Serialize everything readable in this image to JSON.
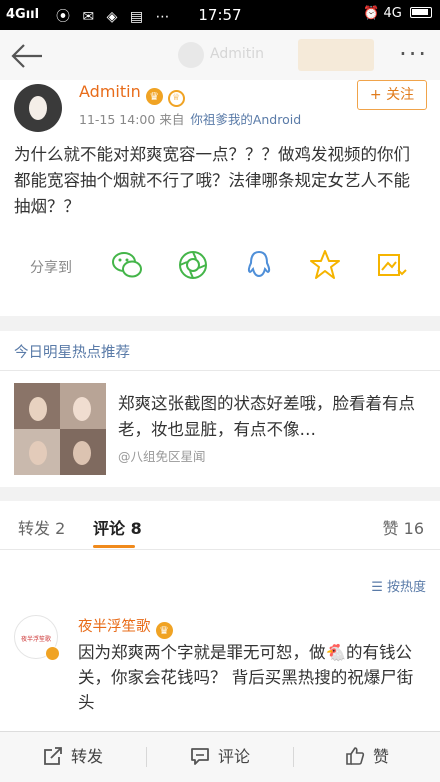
{
  "status": {
    "signal": "4Gııl",
    "time": "17:57",
    "right": "4G"
  },
  "post": {
    "author": "Admitin",
    "time": "11-15 14:00",
    "source_prefix": "来自",
    "source": "你祖爹我的Android",
    "follow_label": "+ 关注",
    "text": "为什么就不能对郑爽宽容一点？？？做鸡发视频的你们都能宽容抽个烟就不行了哦？法律哪条规定女艺人不能抽烟？？",
    "share_label": "分享到",
    "share_icons": [
      "wechat-icon",
      "moments-icon",
      "qq-icon",
      "favorite-star-icon",
      "qzone-icon"
    ]
  },
  "hot": {
    "title": "今日明星热点推荐",
    "text": "郑爽这张截图的状态好差哦，脸看着有点老，妆也显脏，有点不像…",
    "source": "@八组免区星闻"
  },
  "comments": {
    "tabs": {
      "repost": "转发 2",
      "comment": "评论 8",
      "like": "赞 16"
    },
    "sort_label": "按热度",
    "first": {
      "author": "夜半浮笙歌",
      "avatar_text": "夜半浮笙歌",
      "text": "因为郑爽两个字就是罪无可恕，做🐔的有钱公关，你家会花钱吗？ 背后买黑热搜的祝爆尸街头"
    }
  },
  "bottom_bar": {
    "repost": "转发",
    "comment": "评论",
    "like": "赞"
  },
  "colors": {
    "accent": "#f08a1c",
    "author": "#e86c1a",
    "link": "#5a7ba8",
    "share_green": "#44b549",
    "share_blue": "#4f8fd8",
    "share_yellow": "#f5b400"
  }
}
